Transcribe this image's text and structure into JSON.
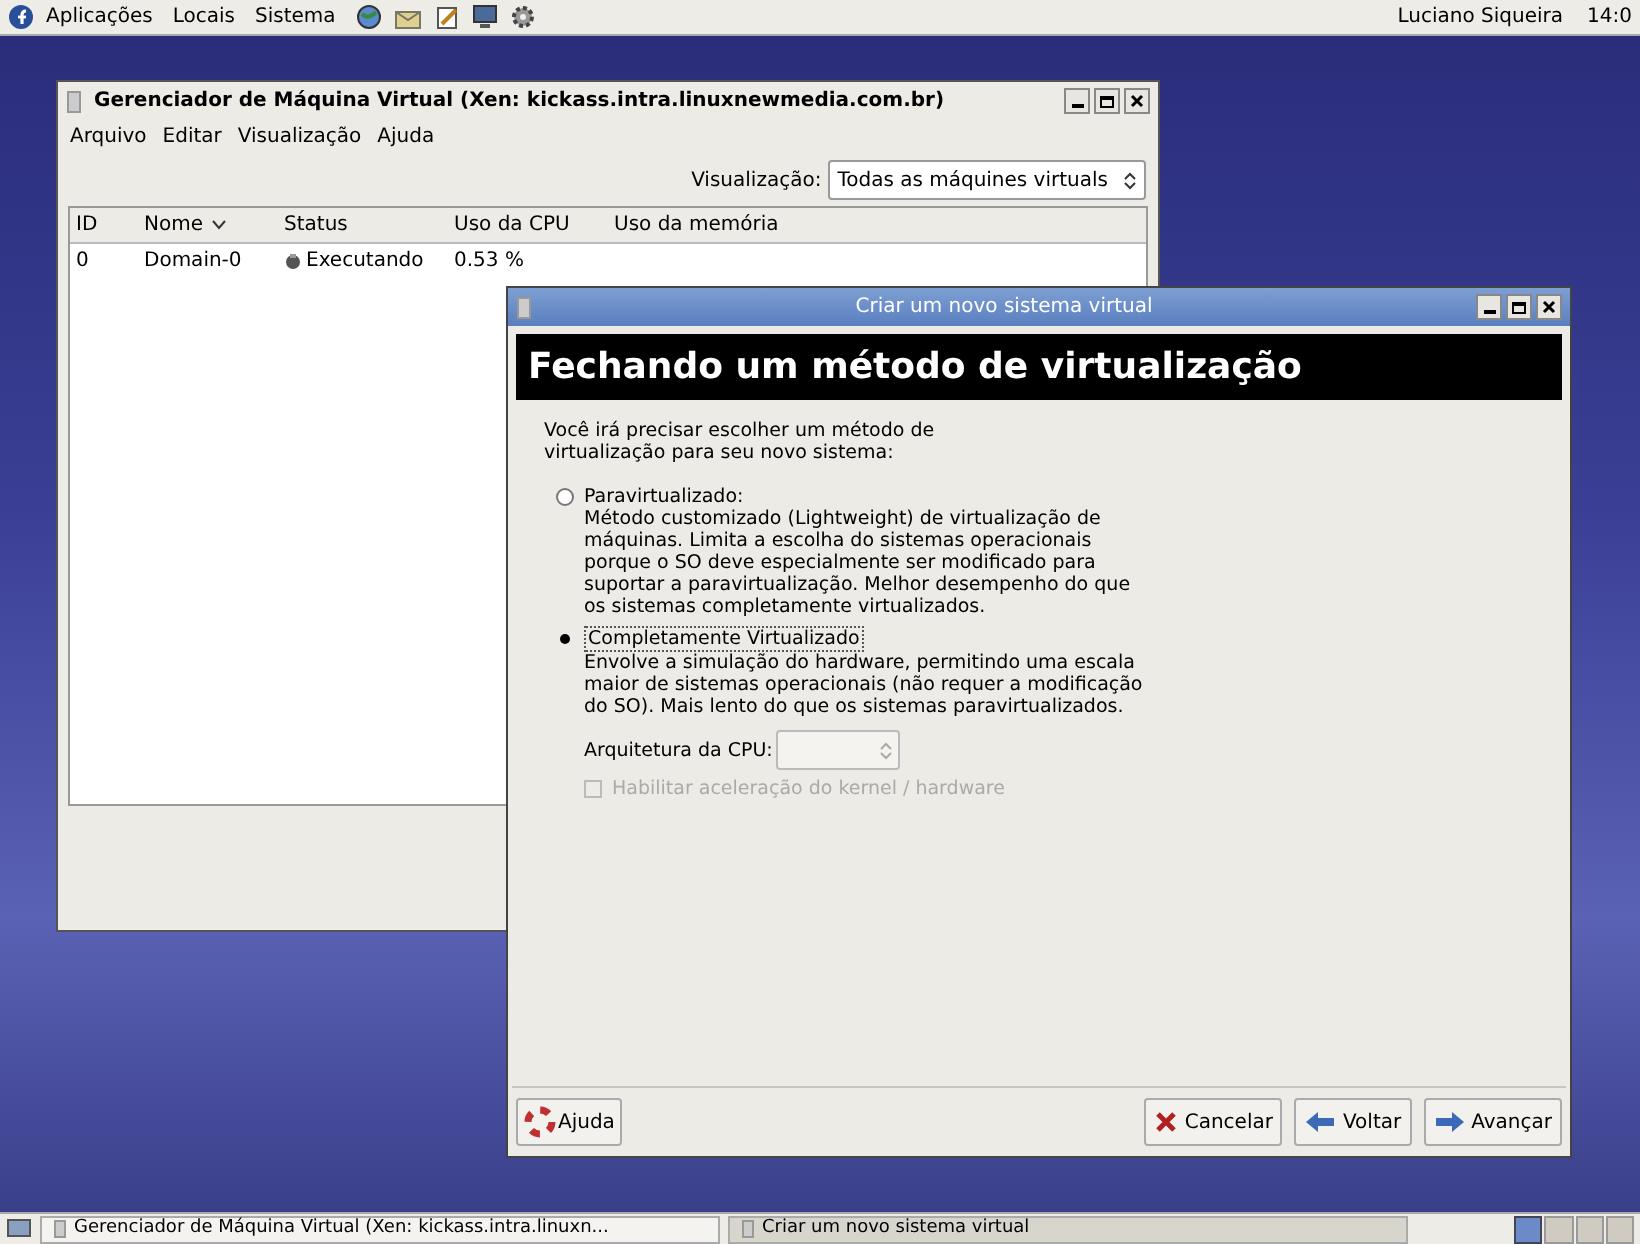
{
  "top_panel": {
    "menus": [
      "Aplicações",
      "Locais",
      "Sistema"
    ],
    "user": "Luciano Siqueira",
    "clock": "14:0"
  },
  "manager_window": {
    "title": "Gerenciador de Máquina Virtual (Xen: kickass.intra.linuxnewmedia.com.br)",
    "menus": [
      "Arquivo",
      "Editar",
      "Visualização",
      "Ajuda"
    ],
    "view_label": "Visualização:",
    "view_value": "Todas as máquines virtuals",
    "columns": [
      "ID",
      "Nome",
      "Status",
      "Uso da CPU",
      "Uso da memória"
    ],
    "rows": [
      {
        "id": "0",
        "name": "Domain-0",
        "status": "Executando",
        "cpu": "0.53 %",
        "selected": false
      }
    ]
  },
  "dialog": {
    "title": "Criar um novo sistema virtual",
    "heading": "Fechando um método de virtualização",
    "intro": "Você irá precisar escolher um método de virtualização para seu novo sistema:",
    "options": [
      {
        "label": "Paravirtualizado:",
        "description": "Método customizado (Lightweight) de virtualização de máquinas. Limita a escolha do sistemas operacionais porque o SO deve especialmente ser modificado para suportar a paravirtualização. Melhor desempenho do que os sistemas completamente virtualizados.",
        "selected": false
      },
      {
        "label": "Completamente Virtualizado",
        "description": "Envolve a simulação do hardware, permitindo uma escala maior de sistemas operacionais (não requer a modificação do SO). Mais lento do que os sistemas paravirtualizados.",
        "selected": true
      }
    ],
    "cpu_arch_label": "Arquitetura da CPU:",
    "accel": {
      "label": "Habilitar aceleração do kernel / hardware",
      "checked": false,
      "disabled": true
    },
    "help_button": "Ajuda",
    "buttons": [
      "Cancelar",
      "Voltar",
      "Avançar"
    ]
  },
  "taskbar": {
    "tasks": [
      {
        "label": "Gerenciador de Máquina Virtual (Xen: kickass.intra.linuxn...",
        "selected": false
      },
      {
        "label": "Criar um novo sistema virtual",
        "selected": true
      }
    ]
  }
}
